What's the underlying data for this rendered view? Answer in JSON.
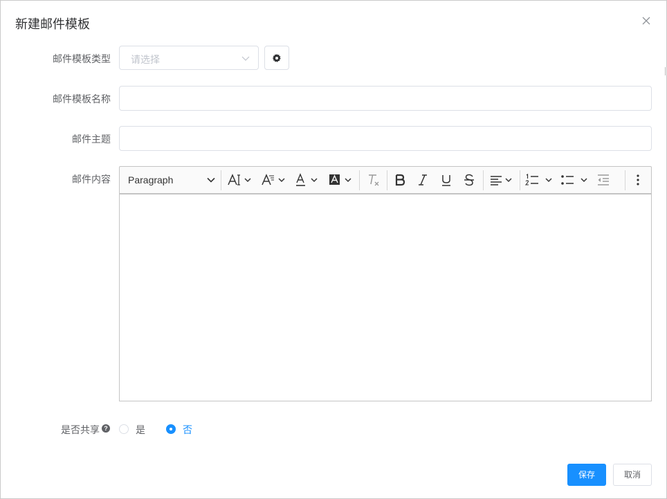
{
  "dialog": {
    "title": "新建邮件模板"
  },
  "form": {
    "type_label": "邮件模板类型",
    "type_placeholder": "请选择",
    "name_label": "邮件模板名称",
    "name_value": "",
    "subject_label": "邮件主题",
    "subject_value": "",
    "content_label": "邮件内容",
    "share_label": "是否共享",
    "share_options": [
      "是",
      "否"
    ],
    "share_selected": "否"
  },
  "editor": {
    "paragraph_label": "Paragraph",
    "toolbar_icons": [
      "font-size-icon",
      "font-family-icon",
      "font-color-icon",
      "font-background-icon",
      "remove-format-icon",
      "bold-icon",
      "italic-icon",
      "underline-icon",
      "strikethrough-icon",
      "align-left-icon",
      "numbered-list-icon",
      "bulleted-list-icon",
      "outdent-icon",
      "more-vertical-icon"
    ],
    "content": ""
  },
  "buttons": {
    "save": "保存",
    "cancel": "取消"
  },
  "colors": {
    "primary": "#1890ff",
    "border": "#dcdfe6",
    "text": "#606266",
    "placeholder": "#c0c4cc"
  }
}
